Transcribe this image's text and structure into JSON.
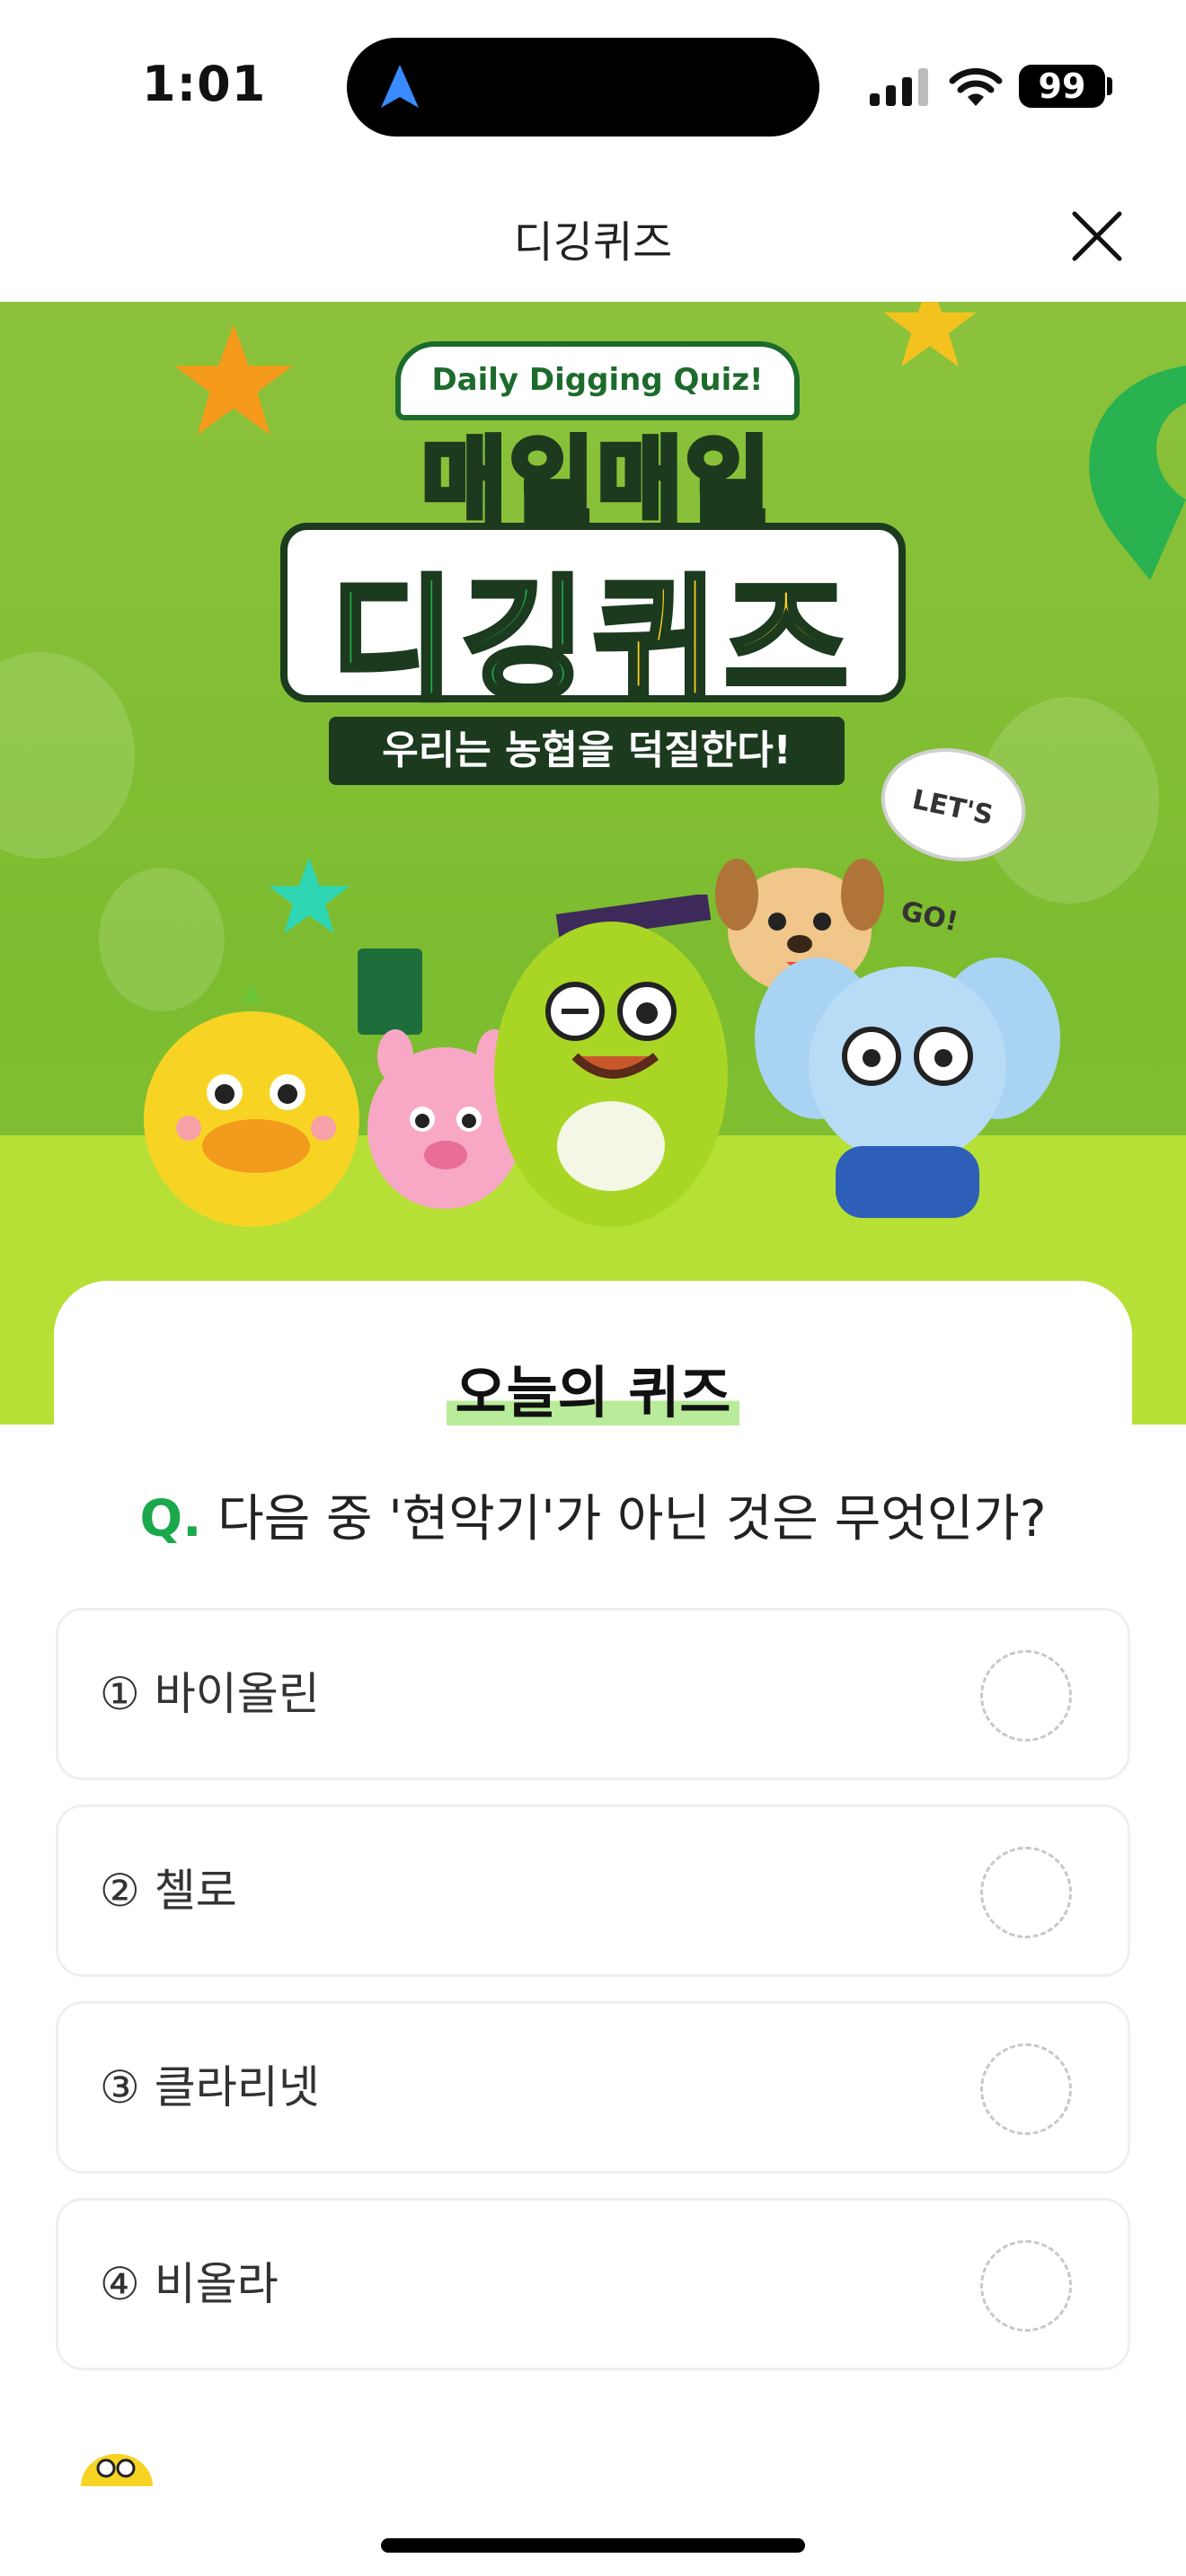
{
  "status_bar": {
    "time": "1:01",
    "battery": "99"
  },
  "header": {
    "title": "디깅퀴즈"
  },
  "banner": {
    "pill": "Daily Digging Quiz!",
    "title_top": "매일매일",
    "title_main_1": "디깅",
    "title_main_2": "퀴즈",
    "slogan": "우리는 농협을 덕질한다!",
    "bubble": "LET'S GO!"
  },
  "quiz": {
    "heading": "오늘의 퀴즈",
    "q_prefix": "Q.",
    "question": "다음 중 '현악기'가 아닌 것은 무엇인가?",
    "options": [
      {
        "label": "① 바이올린"
      },
      {
        "label": "② 첼로"
      },
      {
        "label": "③ 클라리넷"
      },
      {
        "label": "④ 비올라"
      }
    ]
  },
  "colors": {
    "accent_green": "#1aa84b",
    "banner_green": "#8cc23c",
    "floor_lime": "#b6e036"
  }
}
